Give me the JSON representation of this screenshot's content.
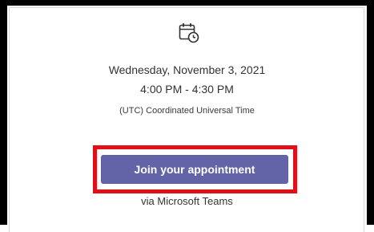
{
  "appointment": {
    "date": "Wednesday, November 3, 2021",
    "time": "4:00 PM - 4:30 PM",
    "timezone": "(UTC) Coordinated Universal Time",
    "icon": "calendar-clock-icon"
  },
  "action": {
    "join_label": "Join your appointment",
    "via_label": "via Microsoft Teams"
  },
  "colors": {
    "button": "#6264a7",
    "highlight": "#e0101a",
    "frame": "#000000"
  }
}
